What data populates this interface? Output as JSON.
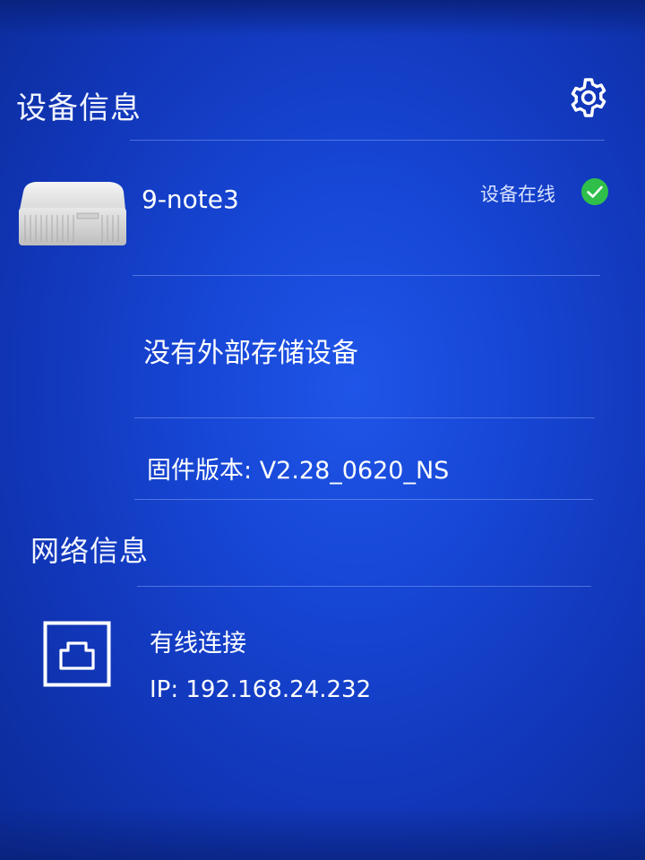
{
  "device_section": {
    "title": "设备信息",
    "settings_icon": "gear-icon",
    "device": {
      "name": "9-note3",
      "status": "设备在线",
      "status_icon": "check-circle-icon",
      "status_color": "#2fbf4a",
      "image_icon": "router-device-image"
    },
    "storage_message": "没有外部存储设备",
    "firmware": {
      "label": "固件版本: ",
      "value": "V2.28_0620_NS"
    }
  },
  "network_section": {
    "title": "网络信息",
    "connection_icon": "ethernet-port-icon",
    "connection_type": "有线连接",
    "ip": {
      "label": "IP: ",
      "value": "192.168.24.232"
    }
  },
  "colors": {
    "background": "#1747d6",
    "text": "#ffffff",
    "divider": "#96b4ff"
  }
}
